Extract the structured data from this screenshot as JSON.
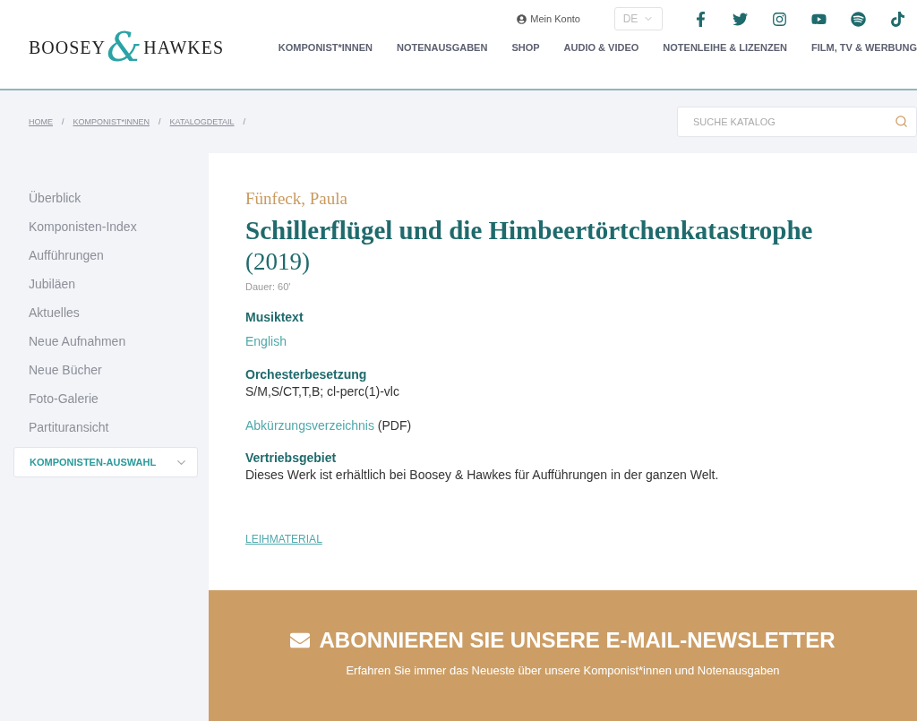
{
  "header": {
    "logo": {
      "left": "BOOSEY",
      "amp": "&",
      "right": "HAWKES"
    },
    "account": "Mein Konto",
    "language": "DE",
    "social": [
      {
        "kind": "facebook"
      },
      {
        "kind": "twitter"
      },
      {
        "kind": "instagram"
      },
      {
        "kind": "youtube"
      },
      {
        "kind": "spotify"
      },
      {
        "kind": "tiktok"
      }
    ],
    "nav": [
      "KOMPONIST*INNEN",
      "NOTENAUSGABEN",
      "SHOP",
      "AUDIO & VIDEO",
      "NOTENLEIHE & LIZENZEN",
      "FILM, TV & WERBUNG"
    ]
  },
  "breadcrumb": [
    "HOME",
    "KOMPONIST*INNEN",
    "KATALOGDETAIL"
  ],
  "breadcrumb_separator": "/",
  "search": {
    "placeholder": "SUCHE KATALOG"
  },
  "sidebar": {
    "items": [
      "Überblick",
      "Komponisten-Index",
      "Aufführungen",
      "Jubiläen",
      "Aktuelles",
      "Neue Aufnahmen",
      "Neue Bücher",
      "Foto-Galerie",
      "Partituransicht"
    ],
    "select": "KOMPONISTEN-AUSWAHL"
  },
  "work": {
    "composer": "Fünfeck, Paula",
    "title": "Schillerflügel und die Himbeertörtchenkatastrophe",
    "year": "(2019)",
    "duration": "Dauer: 60'",
    "sections": [
      {
        "kind": "link",
        "heading": "Musiktext",
        "text": "English"
      },
      {
        "kind": "text",
        "heading": "Orchesterbesetzung",
        "text": "S/M,S/CT,T,B; cl-perc(1)-vlc"
      },
      {
        "kind": "linknote",
        "link": "Abkürzungsverzeichnis",
        "note": "(PDF)"
      },
      {
        "kind": "text",
        "heading": "Vertriebsgebiet",
        "text": "Dieses Werk ist erhältlich bei Boosey & Hawkes für Aufführungen in der ganzen Welt."
      }
    ],
    "rental": "LEIHMATERIAL"
  },
  "newsletter": {
    "title": "ABONNIEREN SIE UNSERE E-MAIL-NEWSLETTER",
    "subtitle": "Erfahren Sie immer das Neueste über unsere Komponist*innen und Notenausgaben"
  }
}
